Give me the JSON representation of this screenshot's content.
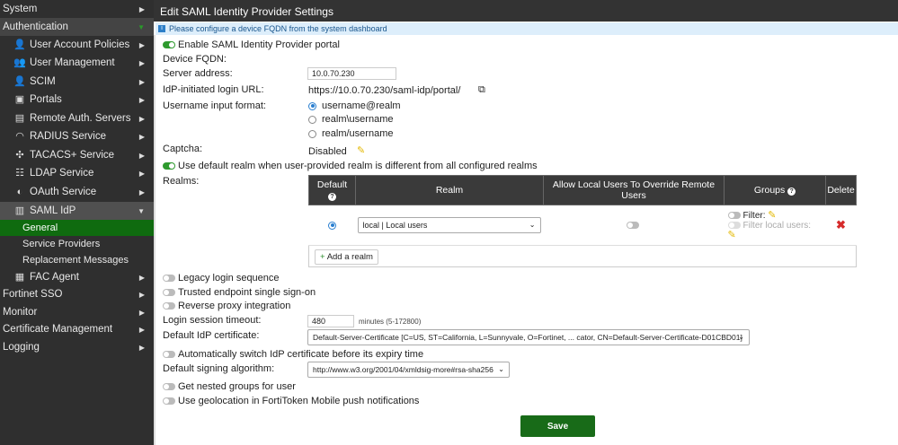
{
  "sidebar": {
    "items": [
      {
        "label": "System"
      },
      {
        "label": "Authentication"
      },
      {
        "label": "User Account Policies"
      },
      {
        "label": "User Management"
      },
      {
        "label": "SCIM"
      },
      {
        "label": "Portals"
      },
      {
        "label": "Remote Auth. Servers"
      },
      {
        "label": "RADIUS Service"
      },
      {
        "label": "TACACS+ Service"
      },
      {
        "label": "LDAP Service"
      },
      {
        "label": "OAuth Service"
      },
      {
        "label": "SAML IdP"
      },
      {
        "label": "General"
      },
      {
        "label": "Service Providers"
      },
      {
        "label": "Replacement Messages"
      },
      {
        "label": "FAC Agent"
      },
      {
        "label": "Fortinet SSO"
      },
      {
        "label": "Monitor"
      },
      {
        "label": "Certificate Management"
      },
      {
        "label": "Logging"
      }
    ]
  },
  "header": {
    "title": "Edit SAML Identity Provider Settings"
  },
  "info": {
    "message": "Please configure a device FQDN from the system dashboard"
  },
  "form": {
    "enable_portal": "Enable SAML Identity Provider portal",
    "device_fqdn": "Device FQDN:",
    "server_address_label": "Server address:",
    "server_address": "10.0.70.230",
    "login_url_label": "IdP-initiated login URL:",
    "login_url": "https://10.0.70.230/saml-idp/portal/",
    "username_format_label": "Username input format:",
    "username_formats": [
      "username@realm",
      "realm\\username",
      "realm/username"
    ],
    "captcha_label": "Captcha:",
    "captcha_value": "Disabled",
    "default_realm": "Use default realm when user-provided realm is different from all configured realms",
    "realms_label": "Realms:",
    "realms_table": {
      "headers": [
        "Default",
        "Realm",
        "Allow Local Users To Override Remote Users",
        "Groups",
        "Delete"
      ],
      "rows": [
        {
          "realm": "local | Local users",
          "filter": "Filter:",
          "filter_local": "Filter local users:"
        }
      ],
      "add": "Add a realm"
    },
    "legacy_login": "Legacy login sequence",
    "trusted_endpoint": "Trusted endpoint single sign-on",
    "reverse_proxy": "Reverse proxy integration",
    "timeout_label": "Login session timeout:",
    "timeout_value": "480",
    "timeout_hint": "minutes (5-172800)",
    "cert_label": "Default IdP certificate:",
    "cert_value": "Default-Server-Certificate [C=US, ST=California, L=Sunnyvale, O=Fortinet, ... cator, CN=Default-Server-Certificate-D01CBD01]",
    "auto_switch": "Automatically switch IdP certificate before its expiry time",
    "signing_label": "Default signing algorithm:",
    "signing_value": "http://www.w3.org/2001/04/xmldsig-more#rsa-sha256",
    "nested_groups": "Get nested groups for user",
    "geolocation": "Use geolocation in FortiToken Mobile push notifications",
    "save": "Save"
  }
}
